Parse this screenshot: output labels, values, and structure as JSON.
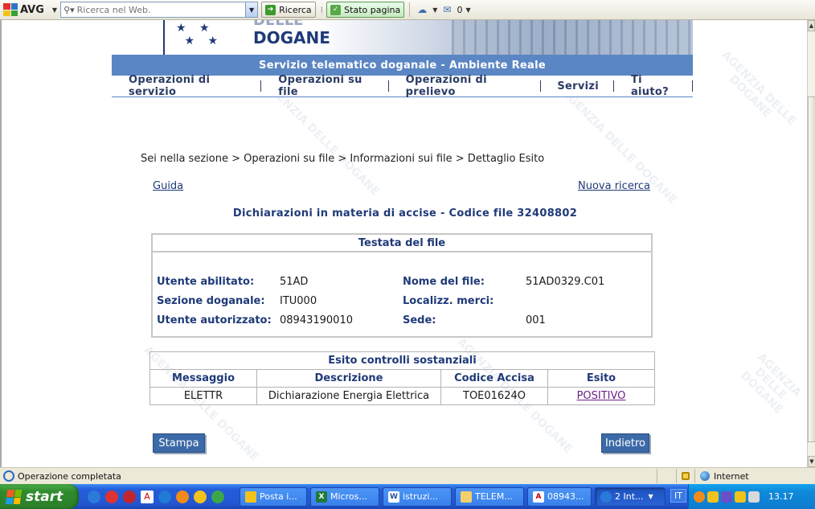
{
  "toolbar": {
    "avg_label": "AVG",
    "search_placeholder": "Ricerca nel Web.",
    "ricerca_label": "Ricerca",
    "stato_pagina_label": "Stato pagina",
    "mail_count": "0"
  },
  "banner": {
    "brand_top": "DELLE",
    "brand": "DOGANE"
  },
  "page": {
    "service_title": "Servizio telematico doganale - Ambiente Reale",
    "menu": [
      "Operazioni di servizio",
      "Operazioni su file",
      "Operazioni di prelievo",
      "Servizi",
      "Ti aiuto?"
    ],
    "breadcrumb": "Sei nella sezione > Operazioni su file > Informazioni sui file > Dettaglio Esito",
    "guida_label": "Guida",
    "nuova_ricerca_label": "Nuova ricerca",
    "doc_title": "Dichiarazioni in materia di accise - Codice file 32408802",
    "watermark": "AGENZIA DELLE DOGANE"
  },
  "testata": {
    "title": "Testata del file",
    "utente_abilitato_label": "Utente abilitato:",
    "utente_abilitato": "51AD",
    "sezione_label": "Sezione doganale:",
    "sezione": "ITU000",
    "utente_autorizzato_label": "Utente autorizzato:",
    "utente_autorizzato": "08943190010",
    "nome_file_label": "Nome del file:",
    "nome_file": "51AD0329.C01",
    "localizz_label": "Localizz. merci:",
    "localizz": "",
    "sede_label": "Sede:",
    "sede": "001"
  },
  "esito": {
    "title": "Esito controlli sostanziali",
    "columns": [
      "Messaggio",
      "Descrizione",
      "Codice Accisa",
      "Esito"
    ],
    "rows": [
      [
        "ELETTR",
        "Dichiarazione Energia Elettrica",
        "TOE01624O",
        "POSITIVO"
      ]
    ]
  },
  "buttons": {
    "stampa": "Stampa",
    "indietro": "Indietro"
  },
  "statusbar": {
    "message": "Operazione completata",
    "zone": "Internet"
  },
  "taskbar": {
    "start_label": "start",
    "tasks": [
      "Posta i...",
      "Micros...",
      "istruzi...",
      "TELEM...",
      "08943...",
      "2 Int..."
    ],
    "lang": "IT",
    "clock": "13.17"
  }
}
